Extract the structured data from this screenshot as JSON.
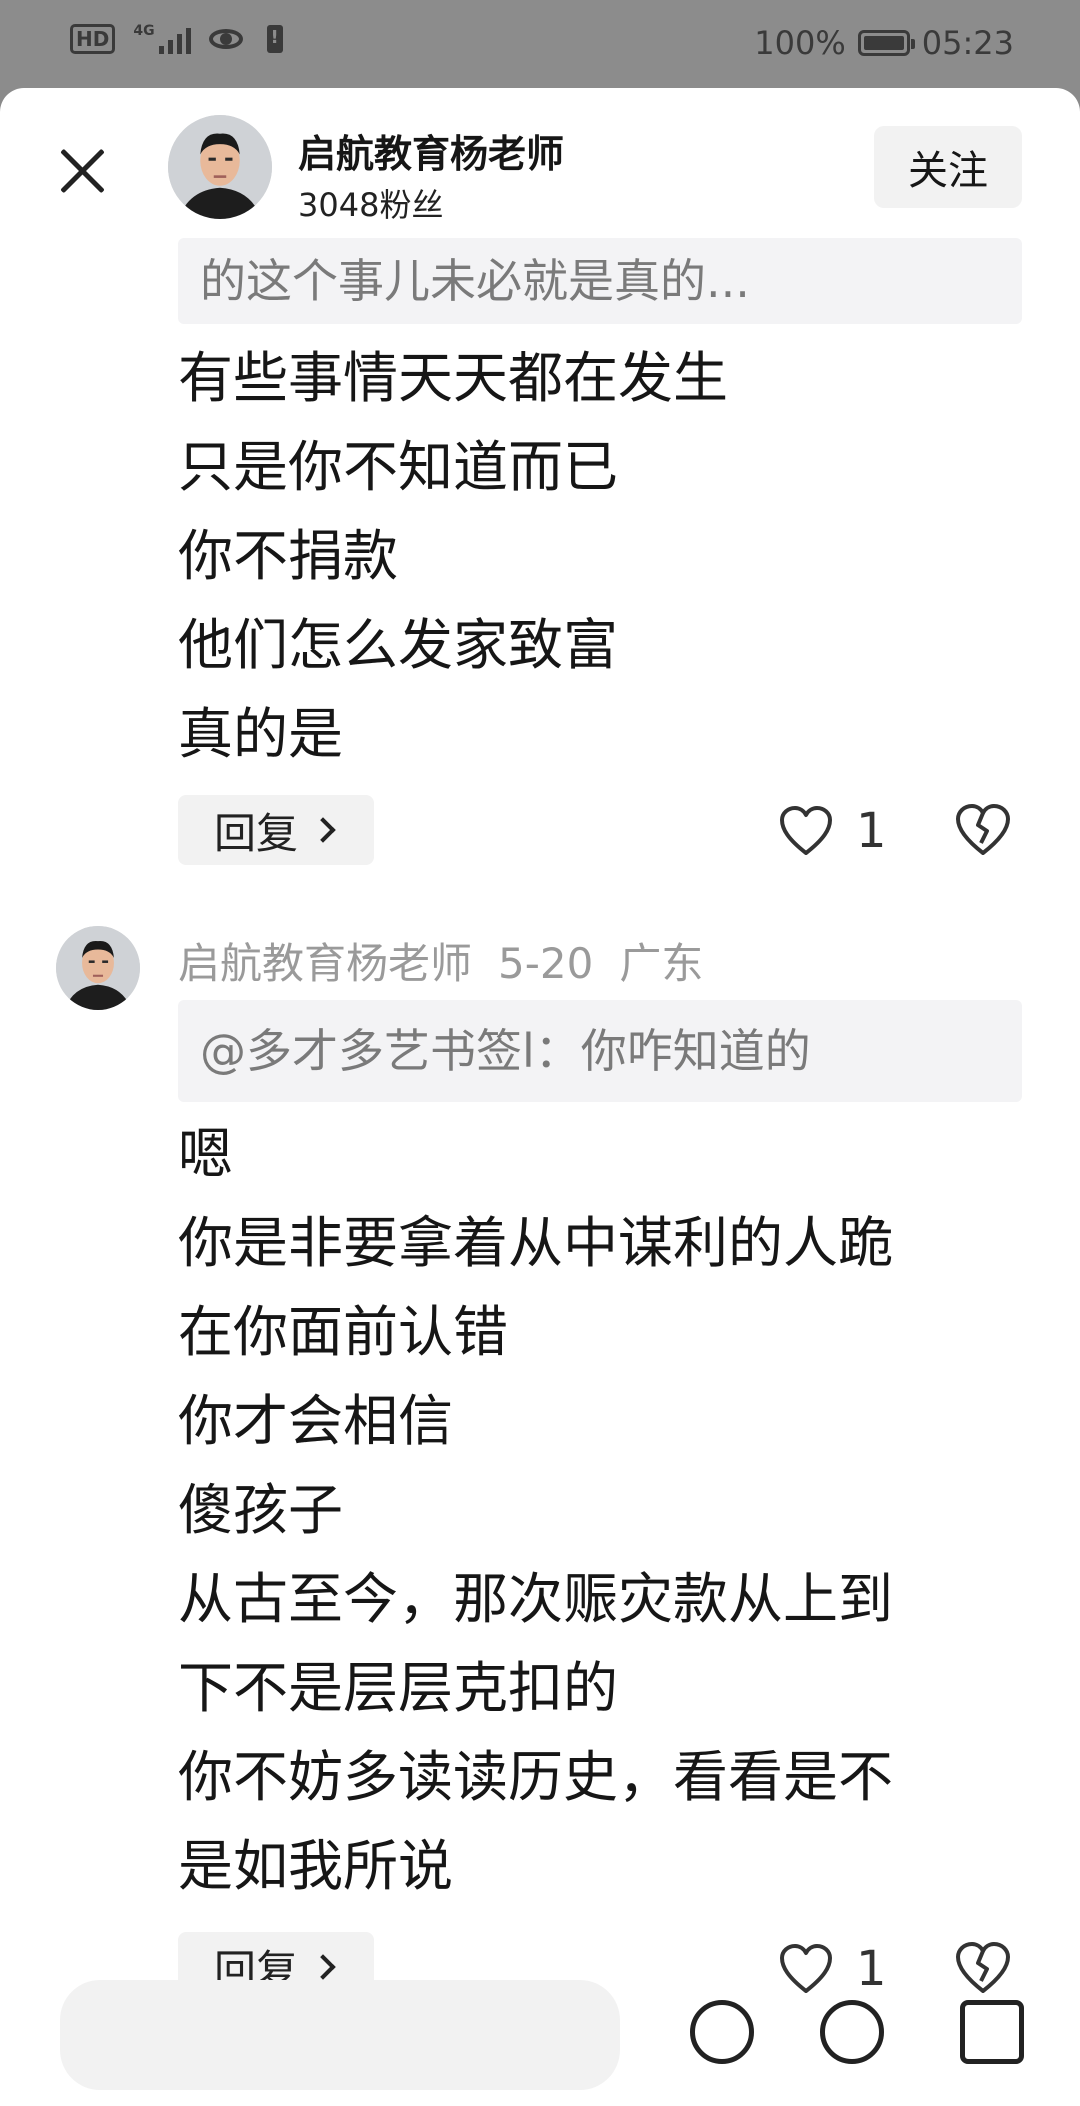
{
  "status_bar": {
    "hd": "HD",
    "network": "4G",
    "battery_pct": "100%",
    "time": "05:23"
  },
  "header": {
    "author_name": "启航教育杨老师",
    "fans": "3048粉丝",
    "follow_label": "关注"
  },
  "comments": [
    {
      "quote": "的这个事儿未必就是真的...",
      "lines": [
        "有些事情天天都在发生",
        "只是你不知道而已",
        "你不捐款",
        "他们怎么发家致富",
        "真的是"
      ],
      "reply_label": "回复",
      "likes": "1"
    },
    {
      "author": "启航教育杨老师",
      "date": "5-20",
      "location": "广东",
      "quote": "@多才多艺书签l：你咋知道的",
      "lines": [
        "嗯",
        "你是非要拿着从中谋利的人跪",
        "在你面前认错",
        "你才会相信",
        "傻孩子",
        "从古至今，那次赈灾款从上到",
        "下不是层层克扣的",
        "你不妨多读读历史，看看是不",
        "是如我所说"
      ],
      "reply_label": "回复",
      "likes": "1"
    }
  ],
  "icons": {
    "close": "close-icon",
    "like": "heart-icon",
    "dislike": "broken-heart-icon"
  }
}
